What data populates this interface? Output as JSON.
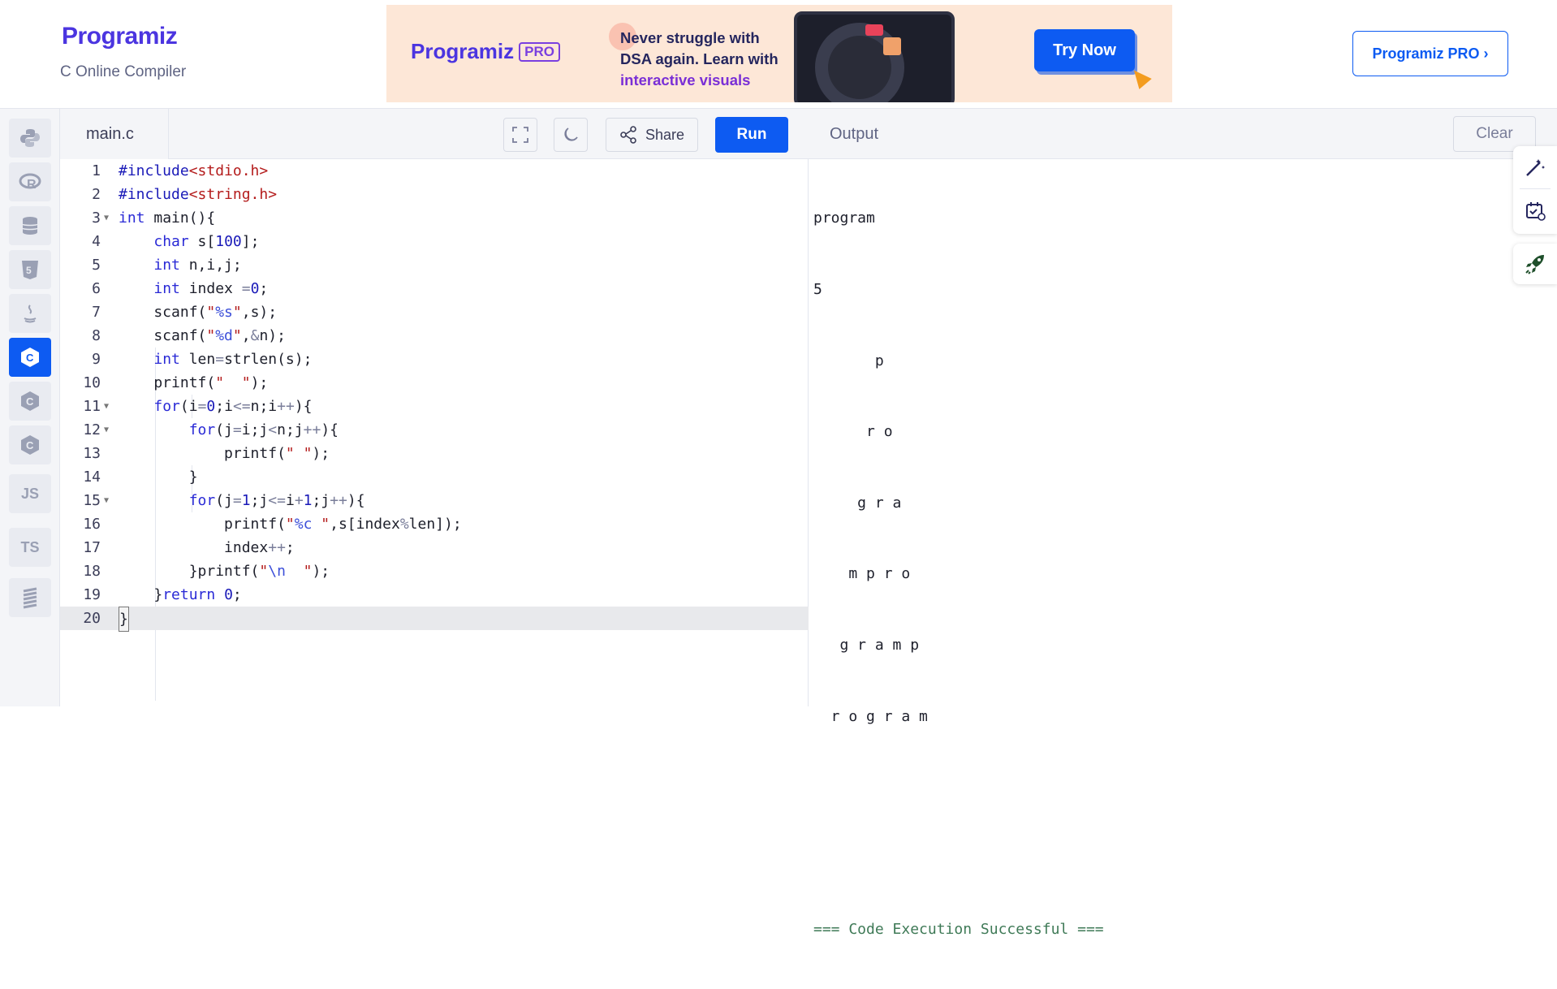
{
  "header": {
    "logo_text": "Programiz",
    "subtitle": "C Online Compiler",
    "banner": {
      "brand": "Programiz",
      "pro_tag": "PRO",
      "line1": "Never struggle with",
      "line2": "DSA again. Learn with",
      "line3": "interactive visuals",
      "cta": "Try Now"
    },
    "pro_button": "Programiz PRO ›"
  },
  "sidebar": {
    "items": [
      {
        "name": "python",
        "label": ""
      },
      {
        "name": "r",
        "label": ""
      },
      {
        "name": "sql",
        "label": ""
      },
      {
        "name": "html",
        "label": ""
      },
      {
        "name": "java",
        "label": ""
      },
      {
        "name": "c",
        "label": "",
        "active": true
      },
      {
        "name": "cpp",
        "label": ""
      },
      {
        "name": "csharp",
        "label": ""
      },
      {
        "name": "js",
        "label": "JS"
      },
      {
        "name": "ts",
        "label": "TS"
      },
      {
        "name": "swift",
        "label": ""
      }
    ]
  },
  "editor": {
    "filename": "main.c",
    "share_label": "Share",
    "run_label": "Run",
    "lines": [
      "#include<stdio.h>",
      "#include<string.h>",
      "int main(){",
      "    char s[100];",
      "    int n,i,j;",
      "    int index =0;",
      "    scanf(\"%s\",s);",
      "    scanf(\"%d\",&n);",
      "    int len=strlen(s);",
      "    printf(\"  \");",
      "    for(i=0;i<=n;i++){",
      "        for(j=i;j<n;j++){",
      "            printf(\" \");",
      "        }",
      "        for(j=1;j<=i+1;j++){",
      "            printf(\"%c \",s[index%len]);",
      "            index++;",
      "        }printf(\"\\n  \");",
      "    }return 0;",
      "}"
    ]
  },
  "output": {
    "title": "Output",
    "clear_label": "Clear",
    "lines": [
      "program",
      "5",
      "       p",
      "      r o",
      "     g r a",
      "    m p r o",
      "   g r a m p",
      "  r o g r a m",
      "",
      "",
      "=== Code Execution Successful ==="
    ]
  }
}
